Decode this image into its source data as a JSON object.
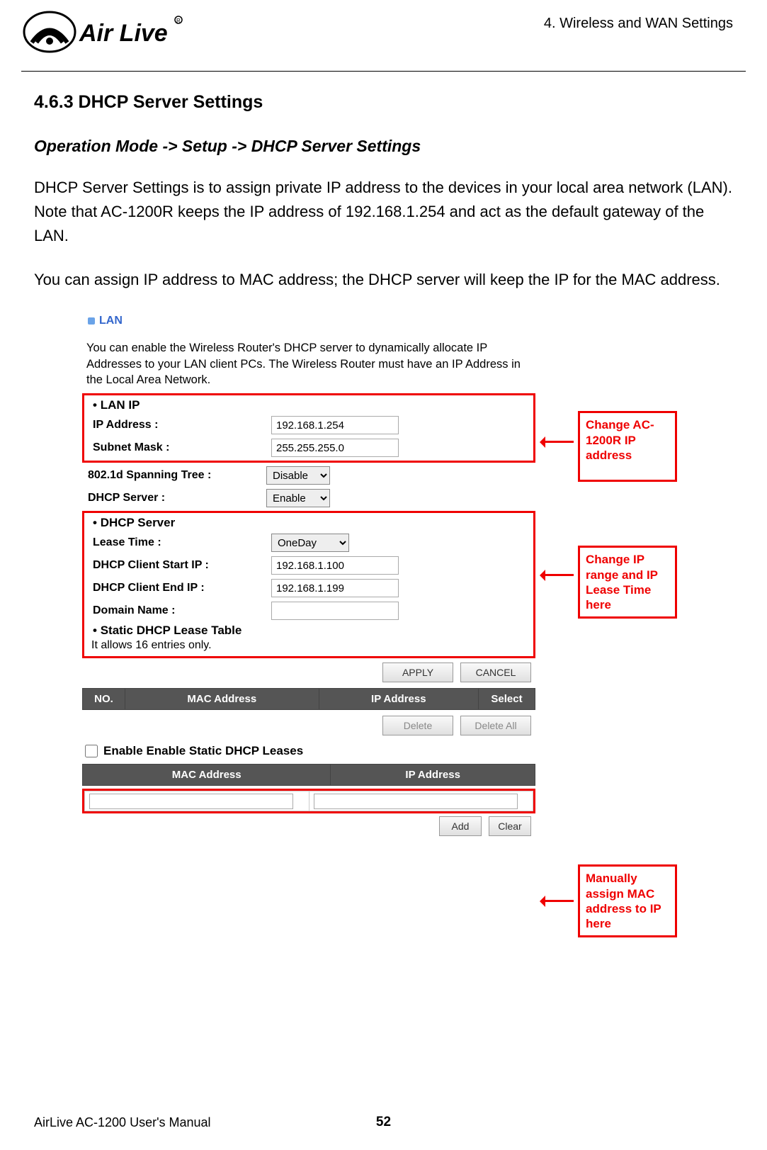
{
  "header": {
    "chapter": "4. Wireless and WAN Settings",
    "logo_alt": "Air Live"
  },
  "section": {
    "title": "4.6.3 DHCP Server Settings",
    "breadcrumb": "Operation Mode -> Setup -> DHCP Server Settings",
    "para1": "DHCP Server Settings is to assign private IP address to the devices in your local area network (LAN). Note that AC-1200R keeps the IP address of 192.168.1.254 and act as the default gateway of the LAN.",
    "para2": "You can assign IP address to MAC address; the DHCP server will keep the IP for the MAC address."
  },
  "ui": {
    "lan_label": "LAN",
    "intro": "You can enable the Wireless Router's DHCP server to dynamically allocate IP Addresses to your LAN client PCs. The Wireless Router must have an IP Address in the Local Area Network.",
    "lan_ip_heading": "LAN IP",
    "ip_address_label": "IP Address :",
    "ip_address_value": "192.168.1.254",
    "subnet_label": "Subnet Mask :",
    "subnet_value": "255.255.255.0",
    "spanning_label": "802.1d Spanning Tree :",
    "spanning_value": "Disable",
    "dhcp_server_label": "DHCP Server :",
    "dhcp_server_value": "Enable",
    "dhcp_heading": "DHCP Server",
    "lease_label": "Lease Time :",
    "lease_value": "OneDay",
    "start_label": "DHCP Client Start IP :",
    "start_value": "192.168.1.100",
    "end_label": "DHCP Client End IP :",
    "end_value": "192.168.1.199",
    "domain_label": "Domain Name :",
    "domain_value": "",
    "static_heading": "Static DHCP Lease Table",
    "static_note": "It allows 16 entries only.",
    "apply": "APPLY",
    "cancel": "CANCEL",
    "delete": "Delete",
    "delete_all": "Delete All",
    "col_no": "NO.",
    "col_mac": "MAC Address",
    "col_ip": "IP Address",
    "col_select": "Select",
    "enable_static": "Enable Enable Static DHCP Leases",
    "col_mac2": "MAC Address",
    "col_ip2": "IP Address",
    "add": "Add",
    "clear": "Clear"
  },
  "callouts": {
    "c1": "Change AC-1200R IP address",
    "c2": "Change IP range and IP Lease Time here",
    "c3": "Manually assign MAC address to IP here"
  },
  "footer": {
    "left": "AirLive AC-1200 User's Manual",
    "page": "52"
  }
}
